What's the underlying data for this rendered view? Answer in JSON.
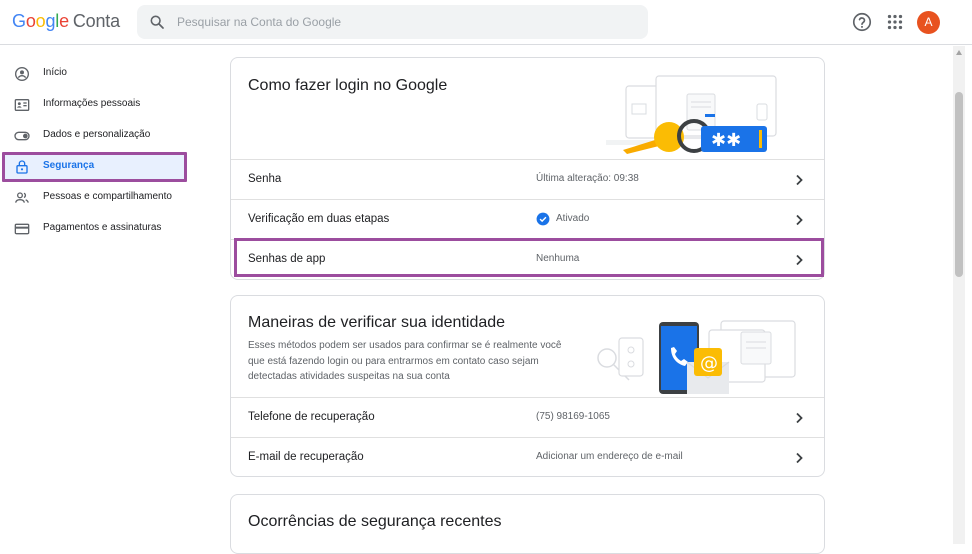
{
  "header": {
    "logo": [
      "G",
      "o",
      "o",
      "g",
      "l",
      "e"
    ],
    "product": "Conta",
    "search_placeholder": "Pesquisar na Conta do Google",
    "avatar_letter": "A"
  },
  "sidebar": {
    "items": [
      {
        "label": "Início",
        "icon": "home-icon"
      },
      {
        "label": "Informações pessoais",
        "icon": "id-card-icon"
      },
      {
        "label": "Dados e personalização",
        "icon": "toggle-icon"
      },
      {
        "label": "Segurança",
        "icon": "lock-icon",
        "active": true
      },
      {
        "label": "Pessoas e compartilhamento",
        "icon": "people-icon"
      },
      {
        "label": "Pagamentos e assinaturas",
        "icon": "credit-card-icon"
      }
    ]
  },
  "login_card": {
    "title": "Como fazer login no Google",
    "rows": [
      {
        "label": "Senha",
        "value": "Última alteração: 09:38"
      },
      {
        "label": "Verificação em duas etapas",
        "value": "Ativado"
      },
      {
        "label": "Senhas de app",
        "value": "Nenhuma"
      }
    ]
  },
  "identity_card": {
    "title": "Maneiras de verificar sua identidade",
    "description": "Esses métodos podem ser usados para confirmar se é realmente você que está fazendo login ou para entrarmos em contato caso sejam detectadas atividades suspeitas na sua conta",
    "rows": [
      {
        "label": "Telefone de recuperação",
        "value": "(75) 98169-1065"
      },
      {
        "label": "E-mail de recuperação",
        "value": "Adicionar um endereço de e-mail"
      }
    ]
  },
  "events_card": {
    "title": "Ocorrências de segurança recentes"
  },
  "colors": {
    "accent": "#1a73e8",
    "highlight_border": "#9c4d9e",
    "avatar": "#e8521f"
  }
}
